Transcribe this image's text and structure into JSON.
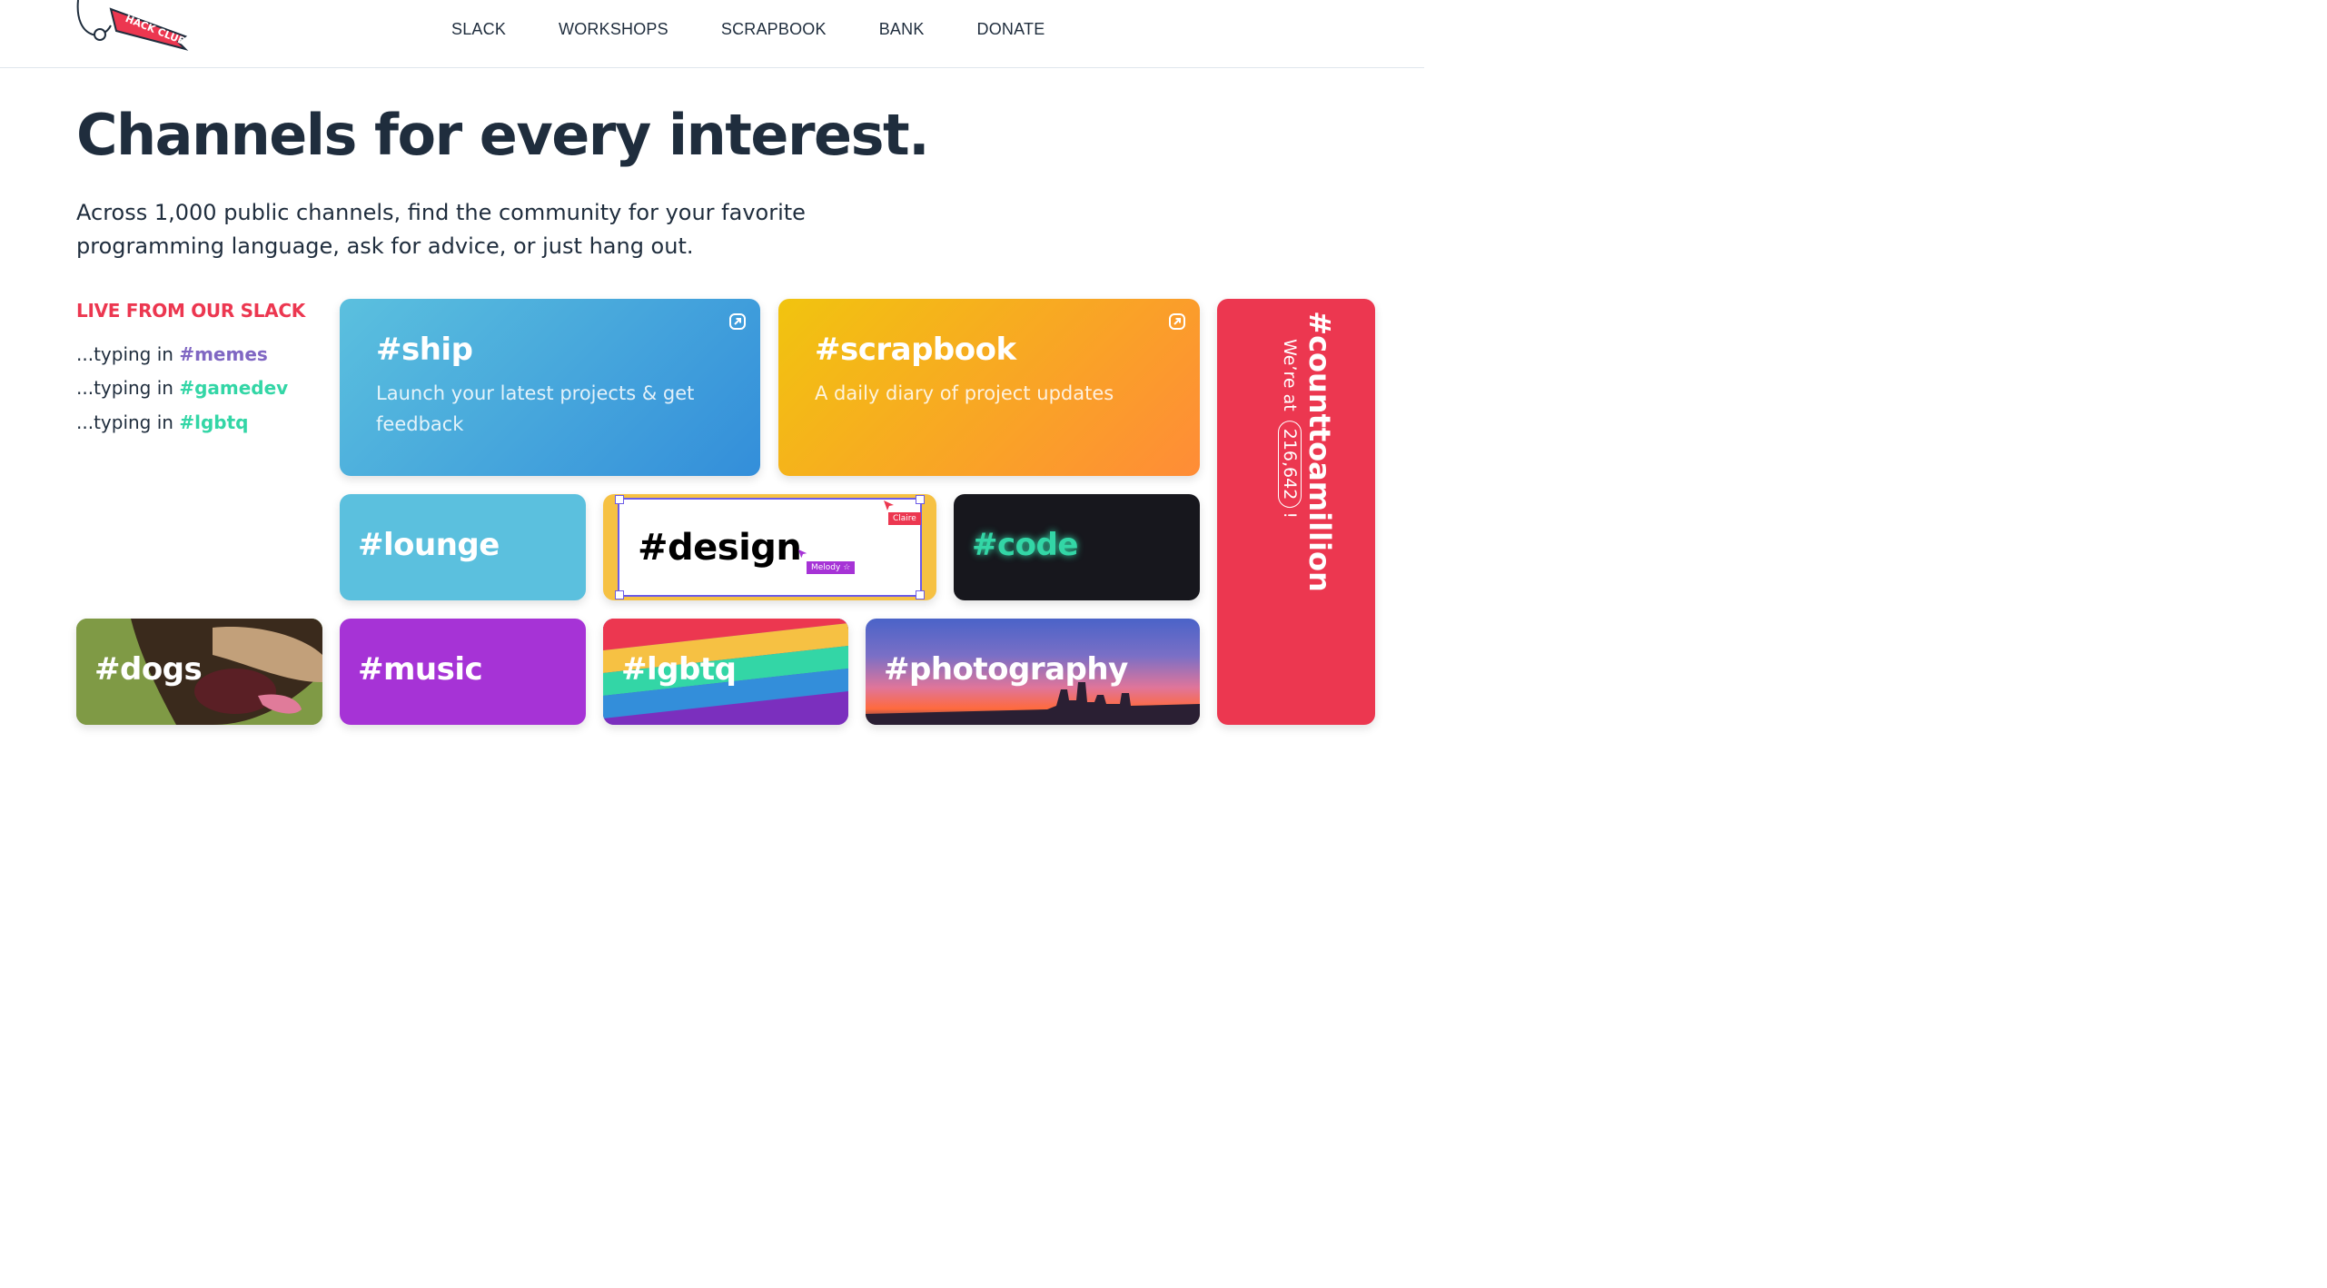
{
  "header": {
    "logo_text": "HACK CLUB",
    "nav": [
      "SLACK",
      "WORKSHOPS",
      "SCRAPBOOK",
      "BANK",
      "DONATE"
    ]
  },
  "hero": {
    "title": "Channels for every interest.",
    "lead": "Across 1,000 public channels, find the community for your favorite programming language, ask for advice, or just hang out."
  },
  "live": {
    "title": "LIVE FROM OUR SLACK",
    "prefix": "...typing in ",
    "items": [
      {
        "channel": "#memes",
        "color": "#8067c3"
      },
      {
        "channel": "#gamedev",
        "color": "#33d6a6"
      },
      {
        "channel": "#lgbtq",
        "color": "#33d6a6"
      }
    ]
  },
  "cards": {
    "ship": {
      "name": "#ship",
      "desc": "Launch your latest projects & get feedback"
    },
    "scrapbook": {
      "name": "#scrapbook",
      "desc": "A daily diary of project updates"
    },
    "lounge": {
      "name": "#lounge"
    },
    "design": {
      "name": "#design",
      "cursor1": "Claire",
      "cursor2": "Melody ☆"
    },
    "code": {
      "name": "#code"
    },
    "counttoamillion": {
      "name": "#counttoamillion",
      "prefix": "We’re at",
      "count": "216,642",
      "suffix": "!"
    },
    "dogs": {
      "name": "#dogs"
    },
    "music": {
      "name": "#music"
    },
    "lgbtq": {
      "name": "#lgbtq"
    },
    "photography": {
      "name": "#photography"
    }
  },
  "colors": {
    "red": "#ec3750",
    "dark": "#1f2d3d",
    "purple_cursor": "#6b5be8",
    "code_glow": "#33d6a6"
  },
  "icons": [
    "external-link-icon",
    "cursor-icon"
  ]
}
